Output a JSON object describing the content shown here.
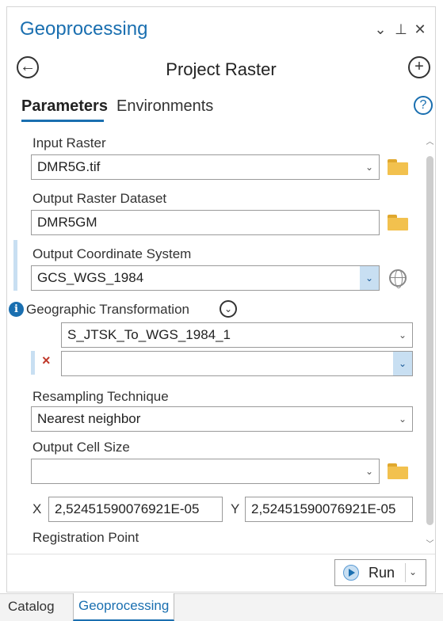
{
  "window": {
    "title": "Geoprocessing",
    "controls": {
      "dropdown": "⌄",
      "pin": "⊥",
      "close": "✕"
    }
  },
  "tool": {
    "title": "Project Raster",
    "back_icon": "back-arrow-icon",
    "add_icon": "add-icon"
  },
  "tabs": [
    {
      "label": "Parameters",
      "active": true
    },
    {
      "label": "Environments",
      "active": false
    }
  ],
  "parameters": {
    "input_raster": {
      "label": "Input Raster",
      "value": "DMR5G.tif"
    },
    "output_raster": {
      "label": "Output Raster Dataset",
      "value": "DMR5GM"
    },
    "output_cs": {
      "label": "Output Coordinate System",
      "value": "GCS_WGS_1984"
    },
    "geo_transform": {
      "label": "Geographic Transformation",
      "value": "S_JTSK_To_WGS_1984_1",
      "second_value": ""
    },
    "resampling": {
      "label": "Resampling Technique",
      "value": "Nearest neighbor"
    },
    "cell_size": {
      "label": "Output Cell Size",
      "value": "",
      "x_label": "X",
      "x_value": "2,52451590076921E-05",
      "y_label": "Y",
      "y_value": "2,52451590076921E-05"
    },
    "registration": {
      "label": "Registration Point",
      "x_label": "X",
      "y_label": "Y"
    }
  },
  "footer": {
    "run_label": "Run"
  },
  "bottom_tabs": [
    {
      "label": "Catalog",
      "active": false
    },
    {
      "label": "Geoprocessing",
      "active": true
    }
  ],
  "colors": {
    "accent": "#1a6fb0",
    "folder": "#f2c14e",
    "error": "#c0392b",
    "highlight": "#c8dff2"
  }
}
